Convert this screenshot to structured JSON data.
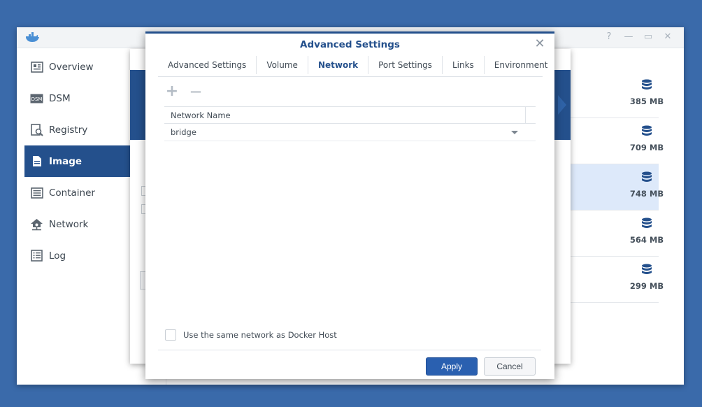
{
  "main_window": {
    "controls": {
      "help": "?",
      "minimize": "—",
      "maximize": "▭",
      "close": "✕"
    }
  },
  "sidebar": {
    "items": [
      {
        "label": "Overview",
        "icon": "overview-icon",
        "active": false
      },
      {
        "label": "DSM",
        "icon": "dsm-icon",
        "active": false
      },
      {
        "label": "Registry",
        "icon": "registry-icon",
        "active": false
      },
      {
        "label": "Image",
        "icon": "image-icon",
        "active": true
      },
      {
        "label": "Container",
        "icon": "container-icon",
        "active": false
      },
      {
        "label": "Network",
        "icon": "network-icon",
        "active": false
      },
      {
        "label": "Log",
        "icon": "log-icon",
        "active": false
      }
    ]
  },
  "image_list": {
    "rows": [
      {
        "size": "385 MB",
        "selected": false
      },
      {
        "size": "709 MB",
        "selected": false
      },
      {
        "size": "748 MB",
        "selected": true
      },
      {
        "size": "564 MB",
        "selected": false
      },
      {
        "size": "299 MB",
        "selected": false
      }
    ]
  },
  "dialog": {
    "title": "Advanced Settings",
    "close": "✕",
    "tabs": [
      {
        "label": "Advanced Settings",
        "active": false
      },
      {
        "label": "Volume",
        "active": false
      },
      {
        "label": "Network",
        "active": true
      },
      {
        "label": "Port Settings",
        "active": false
      },
      {
        "label": "Links",
        "active": false
      },
      {
        "label": "Environment",
        "active": false
      }
    ],
    "toolbar": {
      "add": "+",
      "remove": "—"
    },
    "grid": {
      "header": "Network Name",
      "rows": [
        {
          "value": "bridge"
        }
      ]
    },
    "same_network_label": "Use the same network as Docker Host",
    "same_network_checked": false,
    "apply_label": "Apply",
    "cancel_label": "Cancel"
  },
  "colors": {
    "background": "#3a6aaa",
    "accent": "#24508c",
    "selected_row": "#dde9fa",
    "apply_button": "#2a60b0"
  }
}
